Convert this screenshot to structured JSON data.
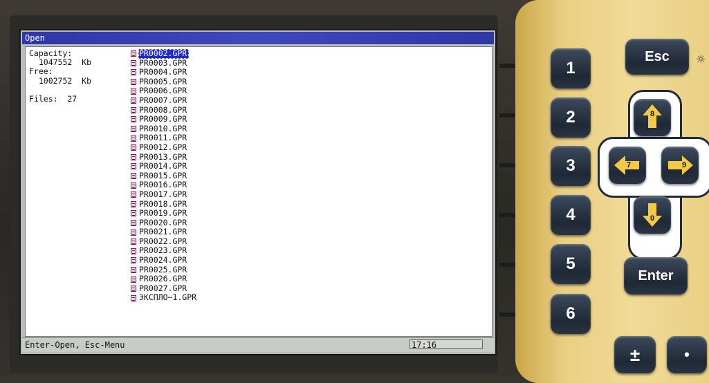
{
  "window": {
    "title": "Open"
  },
  "info": {
    "capacity_label": "Capacity:",
    "capacity_value": "  1047552  Kb",
    "free_label": "Free:",
    "free_value": "  1002752  Kb",
    "files_label": "Files:  27"
  },
  "files": [
    "PR0002.GPR",
    "PR0003.GPR",
    "PR0004.GPR",
    "PR0005.GPR",
    "PR0006.GPR",
    "PR0007.GPR",
    "PR0008.GPR",
    "PR0009.GPR",
    "PR0010.GPR",
    "PR0011.GPR",
    "PR0012.GPR",
    "PR0013.GPR",
    "PR0014.GPR",
    "PR0015.GPR",
    "PR0016.GPR",
    "PR0017.GPR",
    "PR0018.GPR",
    "PR0019.GPR",
    "PR0020.GPR",
    "PR0021.GPR",
    "PR0022.GPR",
    "PR0023.GPR",
    "PR0024.GPR",
    "PR0025.GPR",
    "PR0026.GPR",
    "PR0027.GPR",
    "ЭКСПЛО~1.GPR"
  ],
  "selected_file": "PR0002.GPR",
  "status": {
    "hint": "Enter-Open, Esc-Menu",
    "clock": "17:16"
  },
  "keypad": {
    "esc": "Esc",
    "enter": "Enter",
    "digits": [
      "1",
      "2",
      "3",
      "4",
      "5",
      "6"
    ],
    "up_num": "8",
    "left_num": "7",
    "right_num": "9",
    "down_num": "0",
    "plus_minus": "±",
    "dot": "•"
  },
  "colors": {
    "title_bar": "#2f37a6",
    "selection": "#1f2bd0",
    "panel": "#f0da96",
    "keys": "#1f2835"
  }
}
